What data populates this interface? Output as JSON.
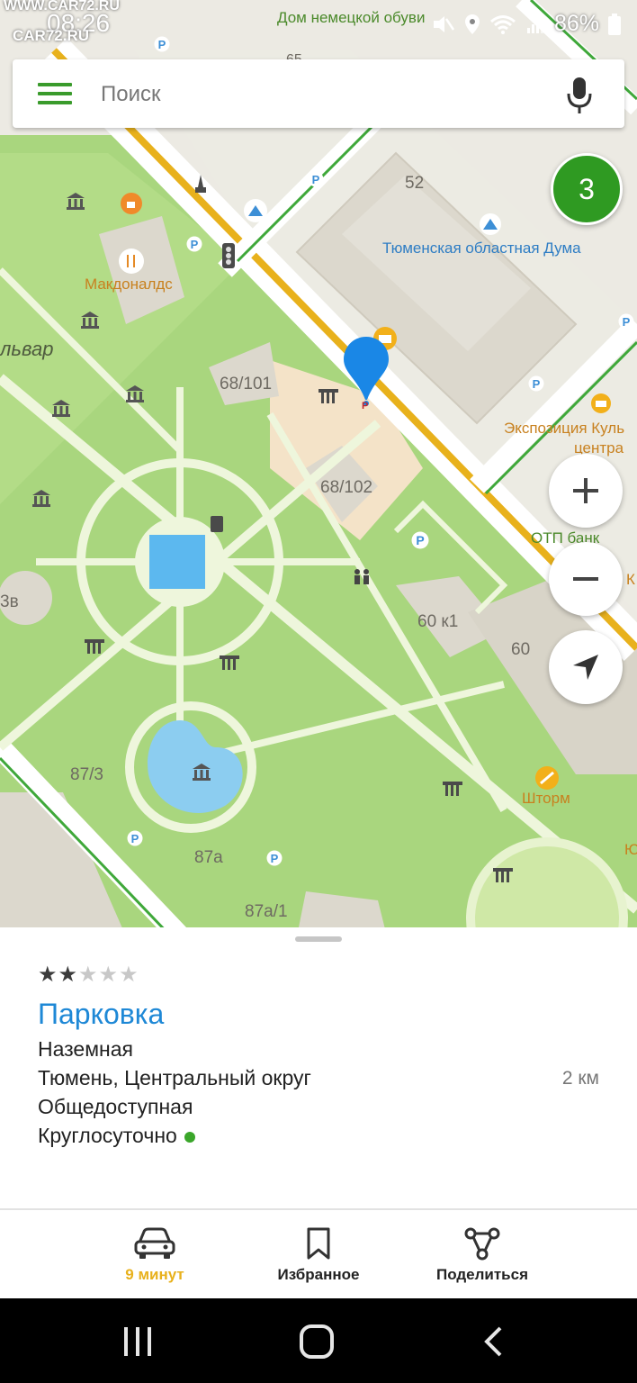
{
  "status_bar": {
    "time": "08:26",
    "watermark_top": "WWW.CAR72.RU",
    "watermark_bottom": "CAR72.RU",
    "battery": "86%"
  },
  "search": {
    "placeholder": "Поиск"
  },
  "map": {
    "top_label": "Дом немецкой обуви",
    "building_65": "65",
    "building_52": "52",
    "duma": "Тюменская областная Дума",
    "mcdonalds": "Макдоналдс",
    "boulevard": "львар",
    "building_68_101": "68/101",
    "building_68_102": "68/102",
    "expo_line1": "Экспозиция Куль",
    "expo_line2": "центра",
    "otp": "ОТП банк",
    "building_60k1": "60 к1",
    "building_60": "60",
    "building_3v": "3в",
    "building_87_3": "87/3",
    "shtorm": "Шторм",
    "building_87a": "87а",
    "building_87a_1": "87а/1",
    "edge_yu": "Ю",
    "edge_k": "К",
    "cluster_count": "3"
  },
  "place": {
    "rating": 2,
    "rating_max": 5,
    "title": "Парковка",
    "type": "Наземная",
    "address": "Тюмень, Центральный округ",
    "distance": "2 км",
    "access": "Общедоступная",
    "hours": "Круглосуточно"
  },
  "actions": {
    "route": "9 минут",
    "favorites": "Избранное",
    "share": "Поделиться"
  },
  "colors": {
    "accent_green": "#3a9b2c",
    "route_yellow": "#e8b11c",
    "link_blue": "#1e88d6",
    "open_dot": "#3aa62a"
  }
}
